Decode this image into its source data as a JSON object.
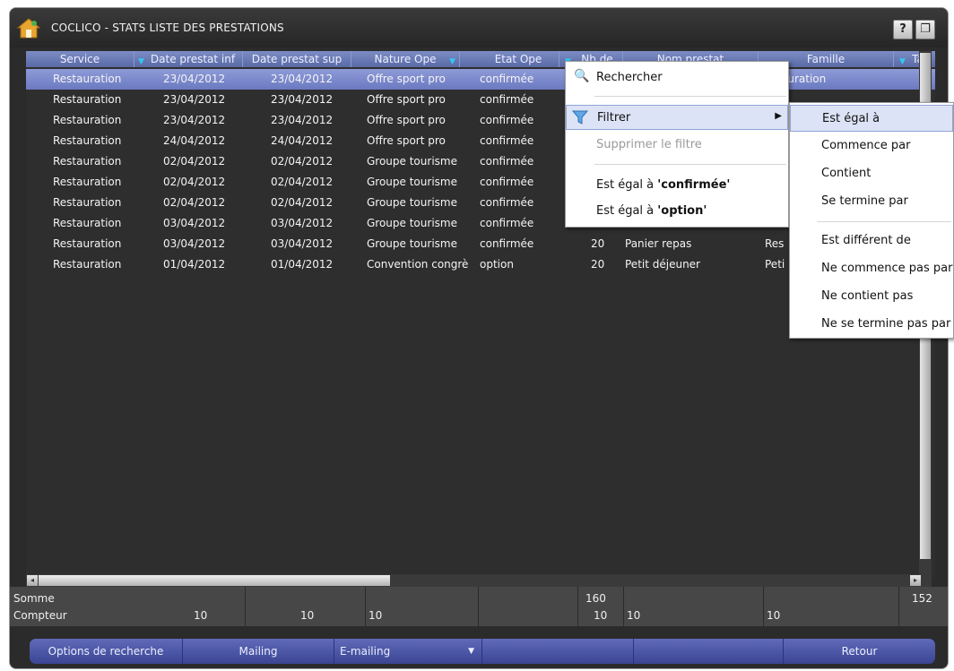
{
  "window": {
    "title": "COCLICO - STATS LISTE DES PRESTATIONS",
    "help_label": "?",
    "max_label": "❐"
  },
  "columns": [
    {
      "label": "Service",
      "filter": false
    },
    {
      "label": "Date prestat inf",
      "filter": true
    },
    {
      "label": "Date prestat sup",
      "filter": false
    },
    {
      "label": "Nature Ope",
      "filter": false
    },
    {
      "label": "Etat Ope",
      "filter": true
    },
    {
      "label": "Nb de",
      "filter": true
    },
    {
      "label": "Nom prestat",
      "filter": false
    },
    {
      "label": "Famille",
      "filter": true
    },
    {
      "label": "Tar",
      "filter": true
    }
  ],
  "rows": [
    {
      "service": "Restauration",
      "date_inf": "23/04/2012",
      "date_sup": "23/04/2012",
      "nature": "Offre sport pro",
      "etat": "confirmée",
      "nb": "",
      "nom": "",
      "famille": "auration",
      "tar": ""
    },
    {
      "service": "Restauration",
      "date_inf": "23/04/2012",
      "date_sup": "23/04/2012",
      "nature": "Offre sport pro",
      "etat": "confirmée",
      "nb": "",
      "nom": "",
      "famille": "",
      "tar": ""
    },
    {
      "service": "Restauration",
      "date_inf": "23/04/2012",
      "date_sup": "23/04/2012",
      "nature": "Offre sport pro",
      "etat": "confirmée",
      "nb": "",
      "nom": "",
      "famille": "",
      "tar": ""
    },
    {
      "service": "Restauration",
      "date_inf": "24/04/2012",
      "date_sup": "24/04/2012",
      "nature": "Offre sport pro",
      "etat": "confirmée",
      "nb": "",
      "nom": "",
      "famille": "",
      "tar": ""
    },
    {
      "service": "Restauration",
      "date_inf": "02/04/2012",
      "date_sup": "02/04/2012",
      "nature": "Groupe tourisme",
      "etat": "confirmée",
      "nb": "",
      "nom": "",
      "famille": "",
      "tar": ""
    },
    {
      "service": "Restauration",
      "date_inf": "02/04/2012",
      "date_sup": "02/04/2012",
      "nature": "Groupe tourisme",
      "etat": "confirmée",
      "nb": "",
      "nom": "",
      "famille": "",
      "tar": ""
    },
    {
      "service": "Restauration",
      "date_inf": "02/04/2012",
      "date_sup": "02/04/2012",
      "nature": "Groupe tourisme",
      "etat": "confirmée",
      "nb": "",
      "nom": "",
      "famille": "",
      "tar": ""
    },
    {
      "service": "Restauration",
      "date_inf": "03/04/2012",
      "date_sup": "03/04/2012",
      "nature": "Groupe tourisme",
      "etat": "confirmée",
      "nb": "",
      "nom": "",
      "famille": "",
      "tar": ""
    },
    {
      "service": "Restauration",
      "date_inf": "03/04/2012",
      "date_sup": "03/04/2012",
      "nature": "Groupe tourisme",
      "etat": "confirmée",
      "nb": "20",
      "nom": "Panier repas",
      "famille": "Res",
      "tar": ""
    },
    {
      "service": "Restauration",
      "date_inf": "01/04/2012",
      "date_sup": "01/04/2012",
      "nature": "Convention congrè",
      "etat": "option",
      "nb": "20",
      "nom": "Petit déjeuner",
      "famille": "Peti",
      "tar": ""
    }
  ],
  "footer": {
    "somme_label": "Somme",
    "compteur_label": "Compteur",
    "somme_nb": "160",
    "somme_tar": "152",
    "compteur_service": "10",
    "compteur_date_inf": "10",
    "compteur_date_sup": "10",
    "compteur_nb": "10",
    "compteur_nom": "10",
    "compteur_famille": "10"
  },
  "context_menu": {
    "rechercher": "Rechercher",
    "filtrer": "Filtrer",
    "supprimer": "Supprimer le filtre",
    "egal_prefix_1": "Est égal à ",
    "egal_value_1": "'confirmée'",
    "egal_prefix_2": "Est égal à ",
    "egal_value_2": "'option'"
  },
  "submenu": {
    "items": [
      "Est égal à",
      "Commence par",
      "Contient",
      "Se termine par",
      "Est différent de",
      "Ne commence pas par",
      "Ne contient pas",
      "Ne se termine pas par"
    ]
  },
  "bottom_buttons": {
    "options": "Options de recherche",
    "mailing": "Mailing",
    "emailing": "E-mailing",
    "retour": "Retour"
  }
}
